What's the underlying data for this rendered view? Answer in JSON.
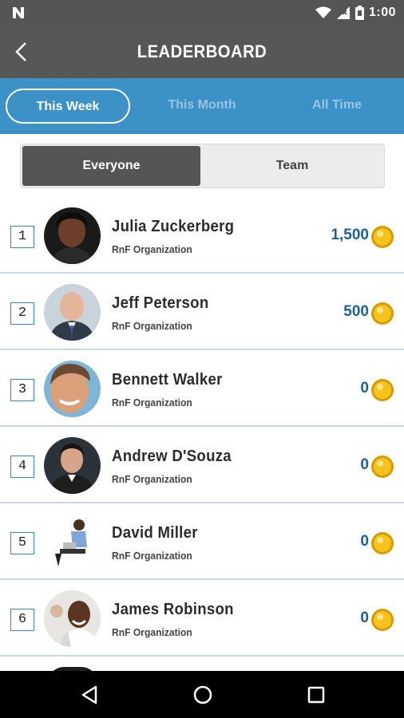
{
  "status_bar": {
    "time": "1:00",
    "icons": [
      "n-logo-icon",
      "wifi-icon",
      "cell-signal-icon",
      "battery-icon"
    ]
  },
  "header": {
    "title": "LEADERBOARD",
    "back_icon": "chevron-left-icon"
  },
  "time_tabs": [
    {
      "label": "This Week",
      "active": true
    },
    {
      "label": "This Month",
      "active": false
    },
    {
      "label": "All Time",
      "active": false
    }
  ],
  "segment": {
    "everyone": "Everyone",
    "team": "Team",
    "selected": "Everyone"
  },
  "leaders": [
    {
      "rank": "1",
      "name": "Julia Zuckerberg",
      "org": "RnF Organization",
      "points": "1,500"
    },
    {
      "rank": "2",
      "name": "Jeff Peterson",
      "org": "RnF Organization",
      "points": "500"
    },
    {
      "rank": "3",
      "name": "Bennett Walker",
      "org": "RnF Organization",
      "points": "0"
    },
    {
      "rank": "4",
      "name": "Andrew D'Souza",
      "org": "RnF Organization",
      "points": "0"
    },
    {
      "rank": "5",
      "name": "David Miller",
      "org": "RnF Organization",
      "points": "0"
    },
    {
      "rank": "6",
      "name": "James Robinson",
      "org": "RnF Organization",
      "points": "0"
    }
  ],
  "colors": {
    "header_bg": "#575757",
    "tab_bar_bg": "#3c91c6",
    "points_text": "#1f5f92",
    "coin": "#f2b705",
    "rank_border": "#3a86b9"
  },
  "nav_bar": {
    "icons": [
      "nav-back-icon",
      "nav-home-icon",
      "nav-recent-icon"
    ]
  }
}
